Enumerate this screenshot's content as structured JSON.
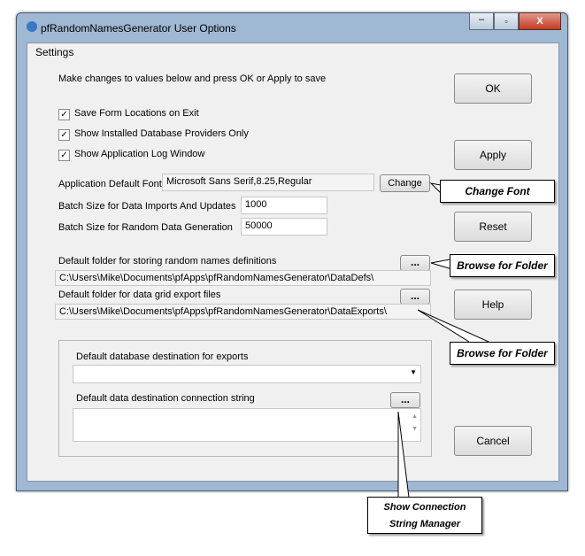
{
  "window": {
    "title": "pfRandomNamesGenerator User Options",
    "controls": {
      "minimize": "minimize-icon",
      "maximize": "maximize-icon",
      "close": "close-icon"
    }
  },
  "settings_label": "Settings",
  "instructions": "Make changes to values below and press OK or Apply to save",
  "checkboxes": [
    {
      "label": "Save Form Locations on Exit",
      "checked": true
    },
    {
      "label": "Show Installed Database Providers Only",
      "checked": true
    },
    {
      "label": "Show Application Log Window",
      "checked": true
    }
  ],
  "font": {
    "label": "Application Default Font",
    "value": "Microsoft Sans Serif,8.25,Regular",
    "change": "Change"
  },
  "batch_imports": {
    "label": "Batch Size for Data Imports And Updates",
    "value": "1000"
  },
  "batch_random": {
    "label": "Batch Size for Random Data Generation",
    "value": "50000"
  },
  "defs_folder": {
    "label": "Default folder for storing random names definitions",
    "value": "C:\\Users\\Mike\\Documents\\pfApps\\pfRandomNamesGenerator\\DataDefs\\",
    "browse": "..."
  },
  "export_folder": {
    "label": "Default folder for data grid export files",
    "value": "C:\\Users\\Mike\\Documents\\pfApps\\pfRandomNamesGenerator\\DataExports\\",
    "browse": "..."
  },
  "db_dest": {
    "label": "Default database destination for exports",
    "value": ""
  },
  "conn_string": {
    "label": "Default data destination connection string",
    "value": "",
    "browse": "..."
  },
  "buttons": {
    "ok": "OK",
    "apply": "Apply",
    "reset": "Reset",
    "help": "Help",
    "cancel": "Cancel"
  },
  "callouts": {
    "change_font": "Change Font",
    "browse1": "Browse for Folder",
    "browse2": "Browse for Folder",
    "conn_line1": "Show Connection",
    "conn_line2": "String Manager"
  }
}
